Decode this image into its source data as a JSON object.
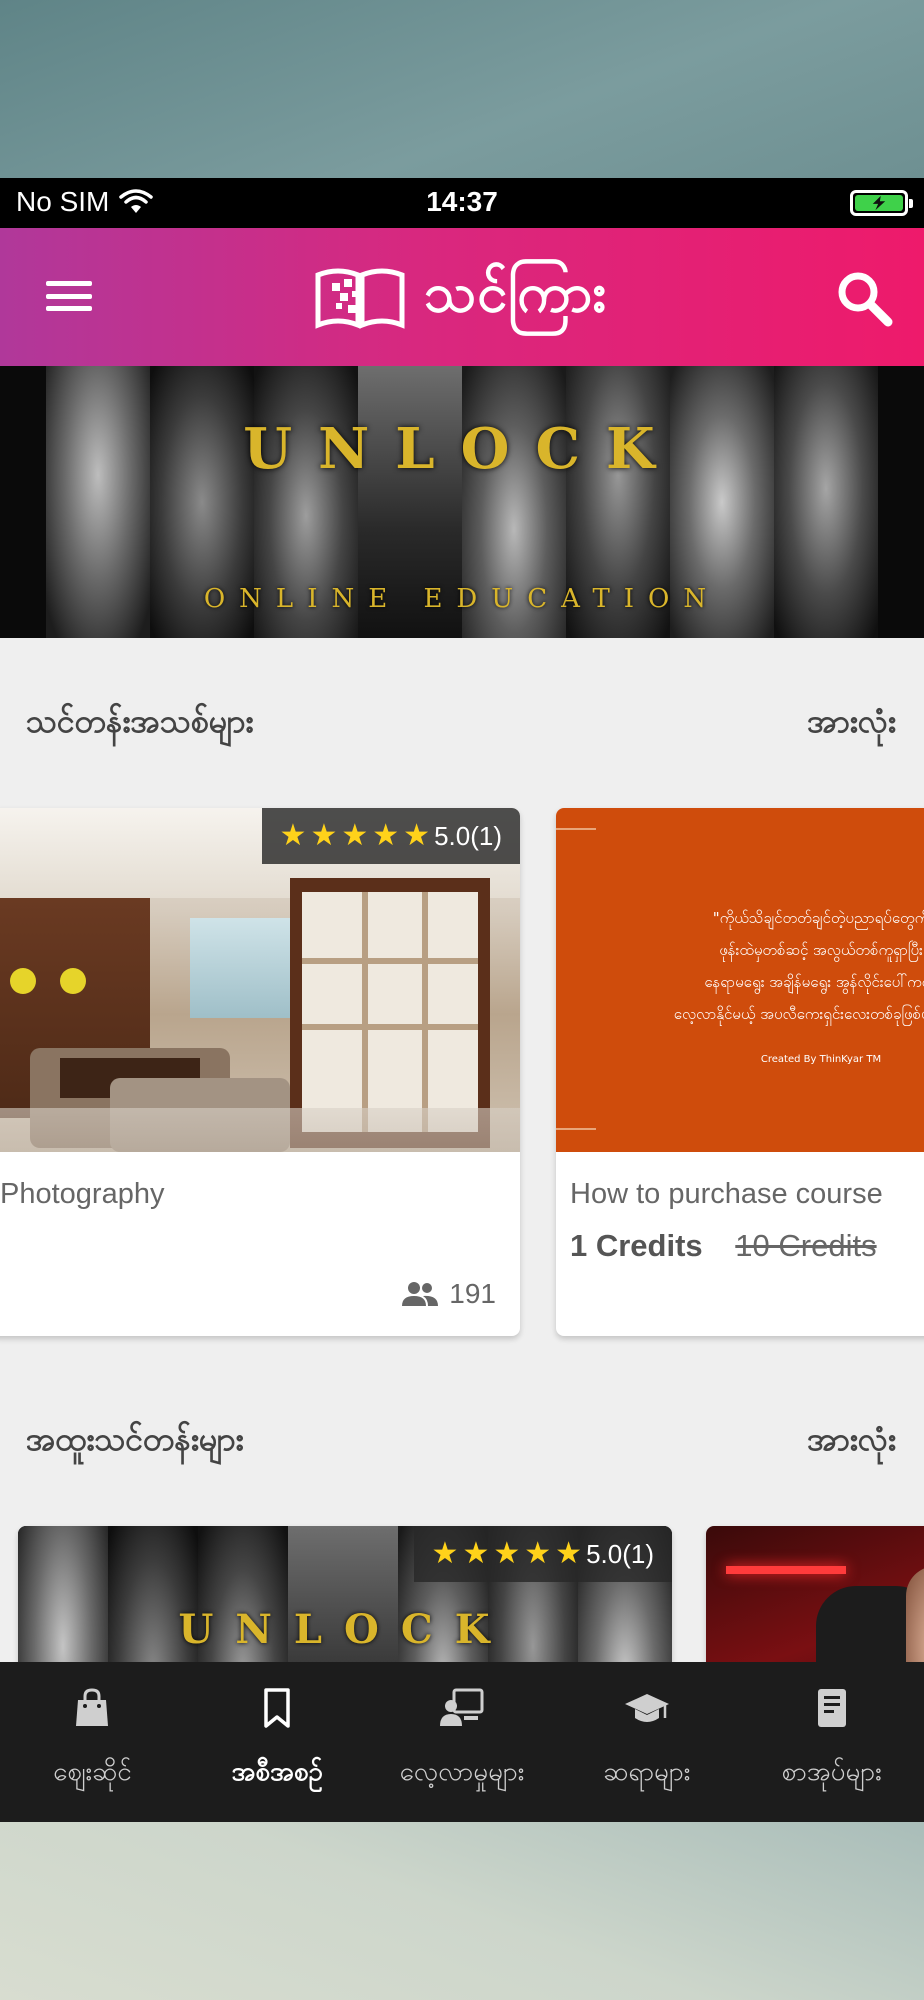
{
  "status_bar": {
    "carrier": "No SIM",
    "time": "14:37"
  },
  "app_bar": {
    "logo_text": "သင်ကြား"
  },
  "banner": {
    "title": "UNLOCK",
    "subtitle": "ONLINE EDUCATION"
  },
  "sections": {
    "new_courses": {
      "title": "သင်တန်းအသစ်များ",
      "see_all": "အားလုံး"
    },
    "special_courses": {
      "title": "အထူးသင်တန်းများ",
      "see_all": "အားလုံး"
    }
  },
  "new_course_cards": [
    {
      "title": "Photography",
      "rating_value": "5.0(1)",
      "rating": 5,
      "students": "191"
    },
    {
      "title": "How to purchase course",
      "price": "1 Credits",
      "old_price": "10 Credits",
      "quote_lines": [
        "\"ကိုယ်သိချင်တတ်ချင်တဲ့ပညာရပ်တွေကို",
        "ဖုန်းထဲမှတစ်ဆင့် အလွယ်တစ်ကူရှာပြီး",
        "နေရာမရွေး အချိန်မရွေး အွန်လိုင်းပေါ်ကနေ",
        "လေ့လာနိုင်မယ့် အပလီကေးရှင်းလေးတစ်ခုဖြစ်ပါတယ်\""
      ],
      "quote_credit": "Created By ThinKyar TM"
    }
  ],
  "special_course_cards": [
    {
      "rating_value": "5.0(1)",
      "rating": 5,
      "banner_title": "UNLOCK"
    }
  ],
  "tab_bar": {
    "items": [
      {
        "label": "ဈေးဆိုင်",
        "icon": "shopping-bag-icon"
      },
      {
        "label": "အစီအစဉ်",
        "icon": "bookmark-icon"
      },
      {
        "label": "လေ့လာမှုများ",
        "icon": "classroom-icon"
      },
      {
        "label": "ဆရာများ",
        "icon": "graduation-cap-icon"
      },
      {
        "label": "စာအုပ်များ",
        "icon": "book-icon"
      }
    ],
    "active_index": 1
  },
  "colors": {
    "app_bar_start": "#b0389a",
    "app_bar_end": "#ee1a6b",
    "star": "#ffd21a",
    "tab_bar": "#1c1c1c"
  }
}
